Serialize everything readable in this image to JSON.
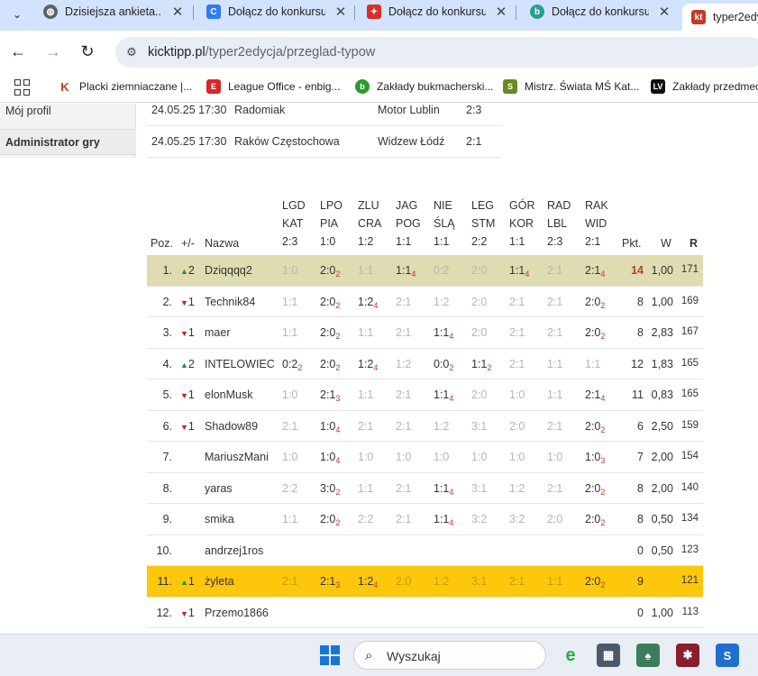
{
  "tabs": [
    {
      "title": "Dzisiejsza ankieta...",
      "icon": "globe-icon",
      "color": "#5f6368"
    },
    {
      "title": "Dołącz do konkursu",
      "icon": "doc-icon",
      "color": "#2f7bf5"
    },
    {
      "title": "Dołącz do konkursu",
      "icon": "gift-icon",
      "color": "#d93025"
    },
    {
      "title": "Dołącz do konkursu",
      "icon": "b-icon",
      "color": "#2a9d8f"
    },
    {
      "title": "typer2edy",
      "icon": "kt-icon",
      "color": "#c0392b",
      "active": true
    }
  ],
  "addressbar": {
    "host": "kicktipp.pl",
    "path": "/typer2edycja/przeglad-typow"
  },
  "bookmarks": [
    {
      "label": "Placki ziemniaczane |...",
      "icon": "k-icon",
      "color": "#c0392b"
    },
    {
      "label": "League Office - enbig...",
      "icon": "e-icon",
      "color": "#d62828"
    },
    {
      "label": "Zakłady bukmacherski...",
      "icon": "b-icon",
      "color": "#2b9a2b"
    },
    {
      "label": "Mistrz. Świata MŚ Kat...",
      "icon": "sts-icon",
      "color": "#6a8a1f"
    },
    {
      "label": "Zakłady przedmec",
      "icon": "lv-icon",
      "color": "#111111"
    }
  ],
  "sidebar": {
    "items": [
      "Mój profil",
      "Administrator gry"
    ]
  },
  "matches": [
    {
      "date": "24.05.25 17:30",
      "home": "Radomiak",
      "away": "Motor Lublin",
      "score": "2:3"
    },
    {
      "date": "24.05.25 17:30",
      "home": "Raków Częstochowa",
      "away": "Widzew Łódź",
      "score": "2:1"
    }
  ],
  "table": {
    "headers": {
      "poz": "Poz.",
      "pm": "+/-",
      "nazwa": "Nazwa",
      "pkt": "Pkt.",
      "w": "W",
      "r": "R"
    },
    "games": [
      {
        "l1": "LGD",
        "l2": "KAT",
        "res": "2:3"
      },
      {
        "l1": "LPO",
        "l2": "PIA",
        "res": "1:0"
      },
      {
        "l1": "ZLU",
        "l2": "CRA",
        "res": "1:2"
      },
      {
        "l1": "JAG",
        "l2": "POG",
        "res": "1:1"
      },
      {
        "l1": "NIE",
        "l2": "ŚLĄ",
        "res": "1:1"
      },
      {
        "l1": "LEG",
        "l2": "STM",
        "res": "2:2"
      },
      {
        "l1": "GÓR",
        "l2": "KOR",
        "res": "1:1"
      },
      {
        "l1": "RAD",
        "l2": "LBL",
        "res": "2:3"
      },
      {
        "l1": "RAK",
        "l2": "WID",
        "res": "2:1"
      }
    ],
    "rows": [
      {
        "poz": "1.",
        "dir": "up",
        "arrow": "▲",
        "delta": "2",
        "name": "Dziqqqq2",
        "hl": "hl1",
        "pkt": "14",
        "pkt_red": true,
        "w": "1,00",
        "r": "171",
        "tips": [
          [
            "1:0",
            "",
            1
          ],
          [
            "2:0",
            "2",
            0
          ],
          [
            "1:1",
            "",
            1
          ],
          [
            "1:1",
            "4",
            0
          ],
          [
            "0:2",
            "",
            1
          ],
          [
            "2:0",
            "",
            1
          ],
          [
            "1:1",
            "4",
            0
          ],
          [
            "2:1",
            "",
            1
          ],
          [
            "2:1",
            "4",
            0
          ]
        ]
      },
      {
        "poz": "2.",
        "dir": "down",
        "arrow": "▼",
        "delta": "1",
        "name": "Technik84",
        "hl": "",
        "pkt": "8",
        "w": "1,00",
        "r": "169",
        "tips": [
          [
            "1:1",
            "",
            1
          ],
          [
            "2:0",
            "2",
            0
          ],
          [
            "1:2",
            "4",
            0
          ],
          [
            "2:1",
            "",
            1
          ],
          [
            "1:2",
            "",
            1
          ],
          [
            "2:0",
            "",
            1
          ],
          [
            "2:1",
            "",
            1
          ],
          [
            "2:1",
            "",
            1
          ],
          [
            "2:0",
            "2",
            0
          ]
        ]
      },
      {
        "poz": "3.",
        "dir": "down",
        "arrow": "▼",
        "delta": "1",
        "name": "maer",
        "hl": "",
        "pkt": "8",
        "w": "2,83",
        "r": "167",
        "tips": [
          [
            "1:1",
            "",
            1
          ],
          [
            "2:0",
            "2",
            0
          ],
          [
            "1:1",
            "",
            1
          ],
          [
            "2:1",
            "",
            1
          ],
          [
            "1:1",
            "4",
            0
          ],
          [
            "2:0",
            "",
            1
          ],
          [
            "2:1",
            "",
            1
          ],
          [
            "2:1",
            "",
            1
          ],
          [
            "2:0",
            "2",
            0
          ]
        ]
      },
      {
        "poz": "4.",
        "dir": "up",
        "arrow": "▲",
        "delta": "2",
        "name": "INTELOWIEC",
        "hl": "",
        "pkt": "12",
        "w": "1,83",
        "r": "165",
        "tips": [
          [
            "0:2",
            "2",
            0
          ],
          [
            "2:0",
            "2",
            0
          ],
          [
            "1:2",
            "4",
            0
          ],
          [
            "1:2",
            "",
            1
          ],
          [
            "0:0",
            "2",
            0
          ],
          [
            "1:1",
            "2",
            0
          ],
          [
            "2:1",
            "",
            1
          ],
          [
            "1:1",
            "",
            1
          ],
          [
            "1:1",
            "",
            1
          ]
        ]
      },
      {
        "poz": "5.",
        "dir": "down",
        "arrow": "▼",
        "delta": "1",
        "name": "elonMusk",
        "hl": "",
        "pkt": "11",
        "w": "0,83",
        "r": "165",
        "tips": [
          [
            "1:0",
            "",
            1
          ],
          [
            "2:1",
            "3",
            0
          ],
          [
            "1:1",
            "",
            1
          ],
          [
            "2:1",
            "",
            1
          ],
          [
            "1:1",
            "4",
            0
          ],
          [
            "2:0",
            "",
            1
          ],
          [
            "1:0",
            "",
            1
          ],
          [
            "1:1",
            "",
            1
          ],
          [
            "2:1",
            "4",
            0
          ]
        ]
      },
      {
        "poz": "6.",
        "dir": "down",
        "arrow": "▼",
        "delta": "1",
        "name": "Shadow89",
        "hl": "",
        "pkt": "6",
        "w": "2,50",
        "r": "159",
        "tips": [
          [
            "2:1",
            "",
            1
          ],
          [
            "1:0",
            "4",
            0
          ],
          [
            "2:1",
            "",
            1
          ],
          [
            "2:1",
            "",
            1
          ],
          [
            "1:2",
            "",
            1
          ],
          [
            "3:1",
            "",
            1
          ],
          [
            "2:0",
            "",
            1
          ],
          [
            "2:1",
            "",
            1
          ],
          [
            "2:0",
            "2",
            0
          ]
        ]
      },
      {
        "poz": "7.",
        "dir": "",
        "arrow": "",
        "delta": "",
        "name": "MariuszMani",
        "hl": "",
        "pkt": "7",
        "w": "2,00",
        "r": "154",
        "tips": [
          [
            "1:0",
            "",
            1
          ],
          [
            "1:0",
            "4",
            0
          ],
          [
            "1:0",
            "",
            1
          ],
          [
            "1:0",
            "",
            1
          ],
          [
            "1:0",
            "",
            1
          ],
          [
            "1:0",
            "",
            1
          ],
          [
            "1:0",
            "",
            1
          ],
          [
            "1:0",
            "",
            1
          ],
          [
            "1:0",
            "3",
            0
          ]
        ]
      },
      {
        "poz": "8.",
        "dir": "",
        "arrow": "",
        "delta": "",
        "name": "yaras",
        "hl": "",
        "pkt": "8",
        "w": "2,00",
        "r": "140",
        "tips": [
          [
            "2:2",
            "",
            1
          ],
          [
            "3:0",
            "2",
            0
          ],
          [
            "1:1",
            "",
            1
          ],
          [
            "2:1",
            "",
            1
          ],
          [
            "1:1",
            "4",
            0
          ],
          [
            "3:1",
            "",
            1
          ],
          [
            "1:2",
            "",
            1
          ],
          [
            "2:1",
            "",
            1
          ],
          [
            "2:0",
            "2",
            0
          ]
        ]
      },
      {
        "poz": "9.",
        "dir": "",
        "arrow": "",
        "delta": "",
        "name": "smika",
        "hl": "",
        "pkt": "8",
        "w": "0,50",
        "r": "134",
        "tips": [
          [
            "1:1",
            "",
            1
          ],
          [
            "2:0",
            "2",
            0
          ],
          [
            "2:2",
            "",
            1
          ],
          [
            "2:1",
            "",
            1
          ],
          [
            "1:1",
            "4",
            0
          ],
          [
            "3:2",
            "",
            1
          ],
          [
            "3:2",
            "",
            1
          ],
          [
            "2:0",
            "",
            1
          ],
          [
            "2:0",
            "2",
            0
          ]
        ]
      },
      {
        "poz": "10.",
        "dir": "",
        "arrow": "",
        "delta": "",
        "name": "andrzej1ros",
        "hl": "",
        "pkt": "0",
        "w": "0,50",
        "r": "123",
        "tips": []
      },
      {
        "poz": "11.",
        "dir": "up",
        "arrow": "▲",
        "delta": "1",
        "name": "żyleta",
        "hl": "hl2",
        "pkt": "9",
        "w": "",
        "r": "121",
        "tips": [
          [
            "2:1",
            "",
            1
          ],
          [
            "2:1",
            "3",
            0
          ],
          [
            "1:2",
            "4",
            0
          ],
          [
            "2:0",
            "",
            1
          ],
          [
            "1:2",
            "",
            1
          ],
          [
            "3:1",
            "",
            1
          ],
          [
            "2:1",
            "",
            1
          ],
          [
            "1:1",
            "",
            1
          ],
          [
            "2:0",
            "2",
            0
          ]
        ]
      },
      {
        "poz": "12.",
        "dir": "down",
        "arrow": "▼",
        "delta": "1",
        "name": "Przemo1866",
        "hl": "",
        "pkt": "0",
        "w": "1,00",
        "r": "113",
        "tips": []
      }
    ]
  },
  "taskbar": {
    "search_placeholder": "Wyszukaj"
  }
}
